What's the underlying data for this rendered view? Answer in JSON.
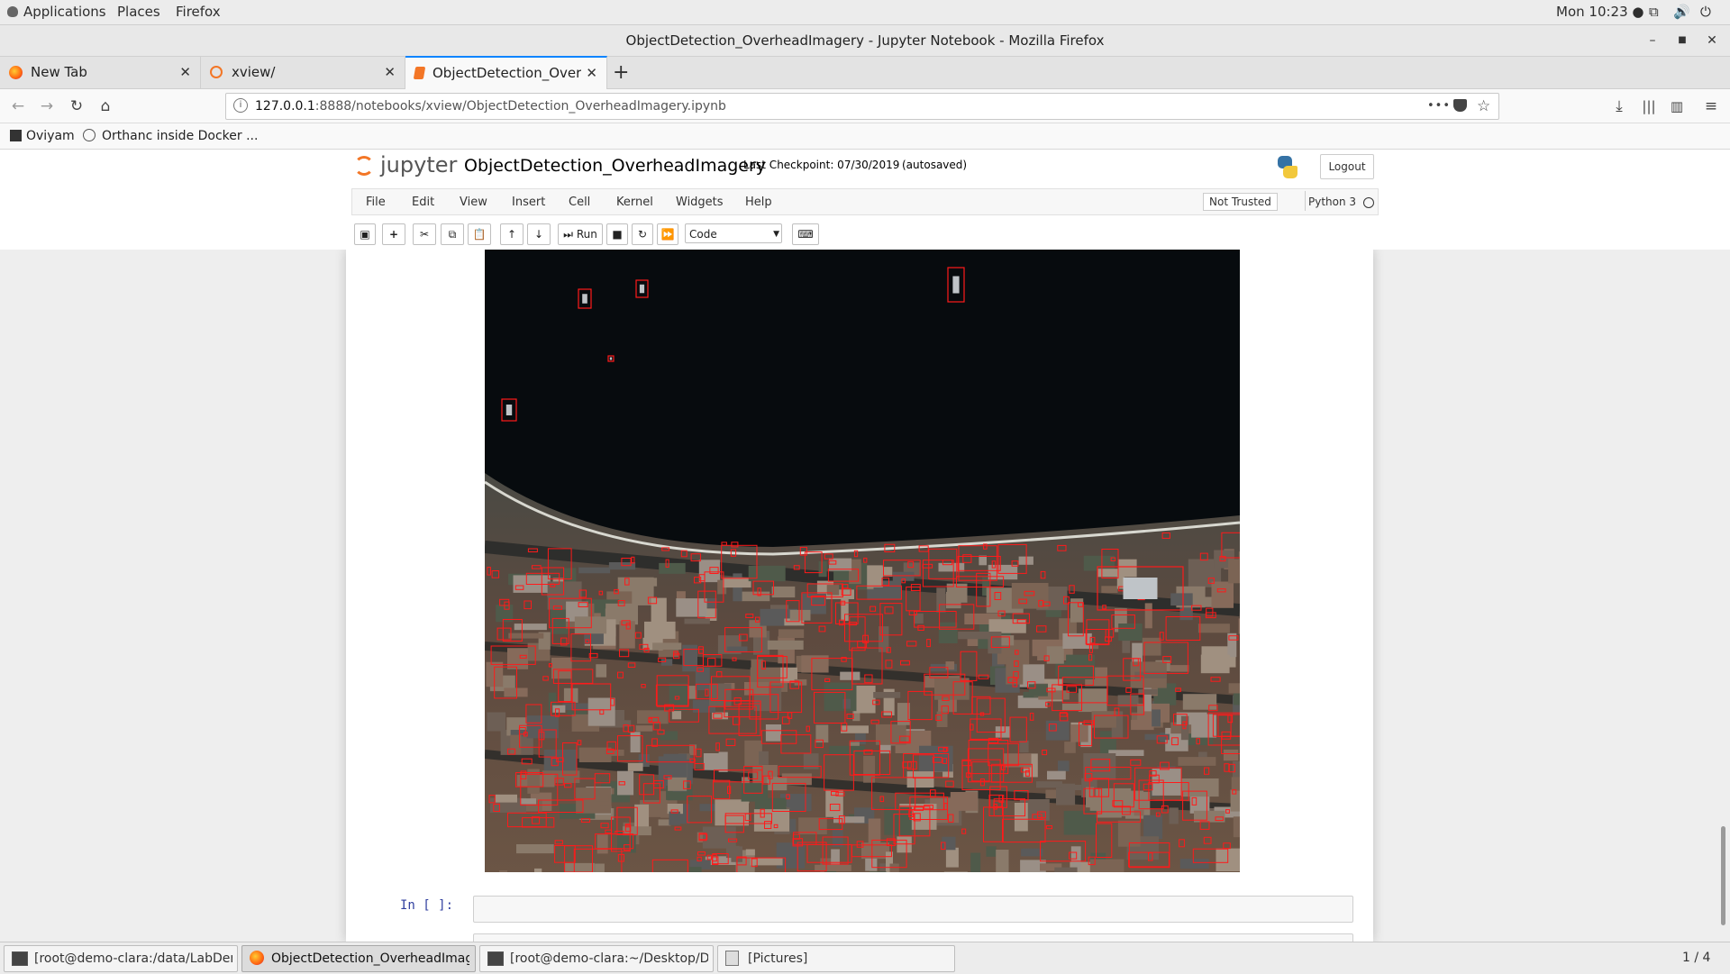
{
  "topbar": {
    "applications": "Applications",
    "places": "Places",
    "firefox": "Firefox",
    "clock": "Mon 10:23 ●"
  },
  "window": {
    "title": "ObjectDetection_OverheadImagery - Jupyter Notebook - Mozilla Firefox"
  },
  "tabs": [
    {
      "label": "New Tab",
      "close": "✕"
    },
    {
      "label": "xview/",
      "close": "✕"
    },
    {
      "label": "ObjectDetection_Overhea",
      "close": "✕"
    }
  ],
  "nav": {
    "url_host": "127.0.0.1",
    "url_rest": ":8888/notebooks/xview/ObjectDetection_OverheadImagery.ipynb",
    "more": "•••"
  },
  "bookmarks": [
    {
      "label": "Oviyam"
    },
    {
      "label": "Orthanc inside Docker ..."
    }
  ],
  "jupyter": {
    "logo_text": "jupyter",
    "notebook_name": "ObjectDetection_OverheadImagery",
    "checkpoint": "Last Checkpoint: 07/30/2019",
    "autosaved": "(autosaved)",
    "logout": "Logout",
    "menu": [
      "File",
      "Edit",
      "View",
      "Insert",
      "Cell",
      "Kernel",
      "Widgets",
      "Help"
    ],
    "not_trusted": "Not Trusted",
    "kernel_name": "Python 3",
    "run_label": "Run",
    "cell_type": "Code"
  },
  "cells": {
    "prompt": "In [ ]:"
  },
  "taskbar": [
    {
      "label": "[root@demo-clara:/data/LabDemos/..."
    },
    {
      "label": "ObjectDetection_OverheadImagery -..."
    },
    {
      "label": "[root@demo-clara:~/Desktop/Demos]"
    },
    {
      "label": "[Pictures]"
    }
  ],
  "workspace": "1 / 4",
  "colors": {
    "accent": "#0a84ff",
    "jupyter_orange": "#f37626",
    "bbox_red": "#ff1a1a"
  }
}
